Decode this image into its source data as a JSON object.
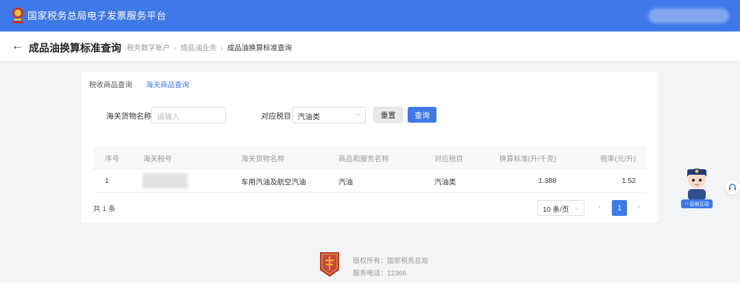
{
  "header": {
    "platform_title": "国家税务总局电子发票服务平台",
    "emblem_icon": "tax-emblem-icon",
    "accent_color": "#3f78e8"
  },
  "page": {
    "back_icon": "←",
    "title": "成品油换算标准查询",
    "breadcrumb": [
      "税务数字账户",
      "成品油业务",
      "成品油换算标准查询"
    ],
    "breadcrumb_separator": "›"
  },
  "tabs": [
    {
      "label": "税收商品查询",
      "active": false
    },
    {
      "label": "海关商品查询",
      "active": true
    }
  ],
  "search": {
    "goods_name_label": "海关货物名称",
    "goods_name_placeholder": "请输入",
    "tax_item_label": "对应税目",
    "tax_item_value": "汽油类",
    "reset_label": "重置",
    "query_label": "查询"
  },
  "table": {
    "columns": [
      "序号",
      "海关税号",
      "海关货物名称",
      "商品和服务名称",
      "对应税目",
      "换算标准(升/千克)",
      "税率(元/升)"
    ],
    "rows": [
      {
        "index": "1",
        "customs_code": "",
        "customs_goods_name": "车用汽油及航空汽油",
        "goods_service_name": "汽油",
        "tax_item": "汽油类",
        "conversion_standard": "1.388",
        "tax_rate": "1.52"
      }
    ]
  },
  "pagination": {
    "total_text": "共 1 条",
    "page_size": "10 条/页",
    "prev": "‹",
    "next": "›",
    "current_page": "1"
  },
  "assistant": {
    "badge_label": "征纳互动"
  },
  "footer": {
    "copyright": "版权所有：国家税务总局",
    "phone": "服务电话：12366"
  }
}
